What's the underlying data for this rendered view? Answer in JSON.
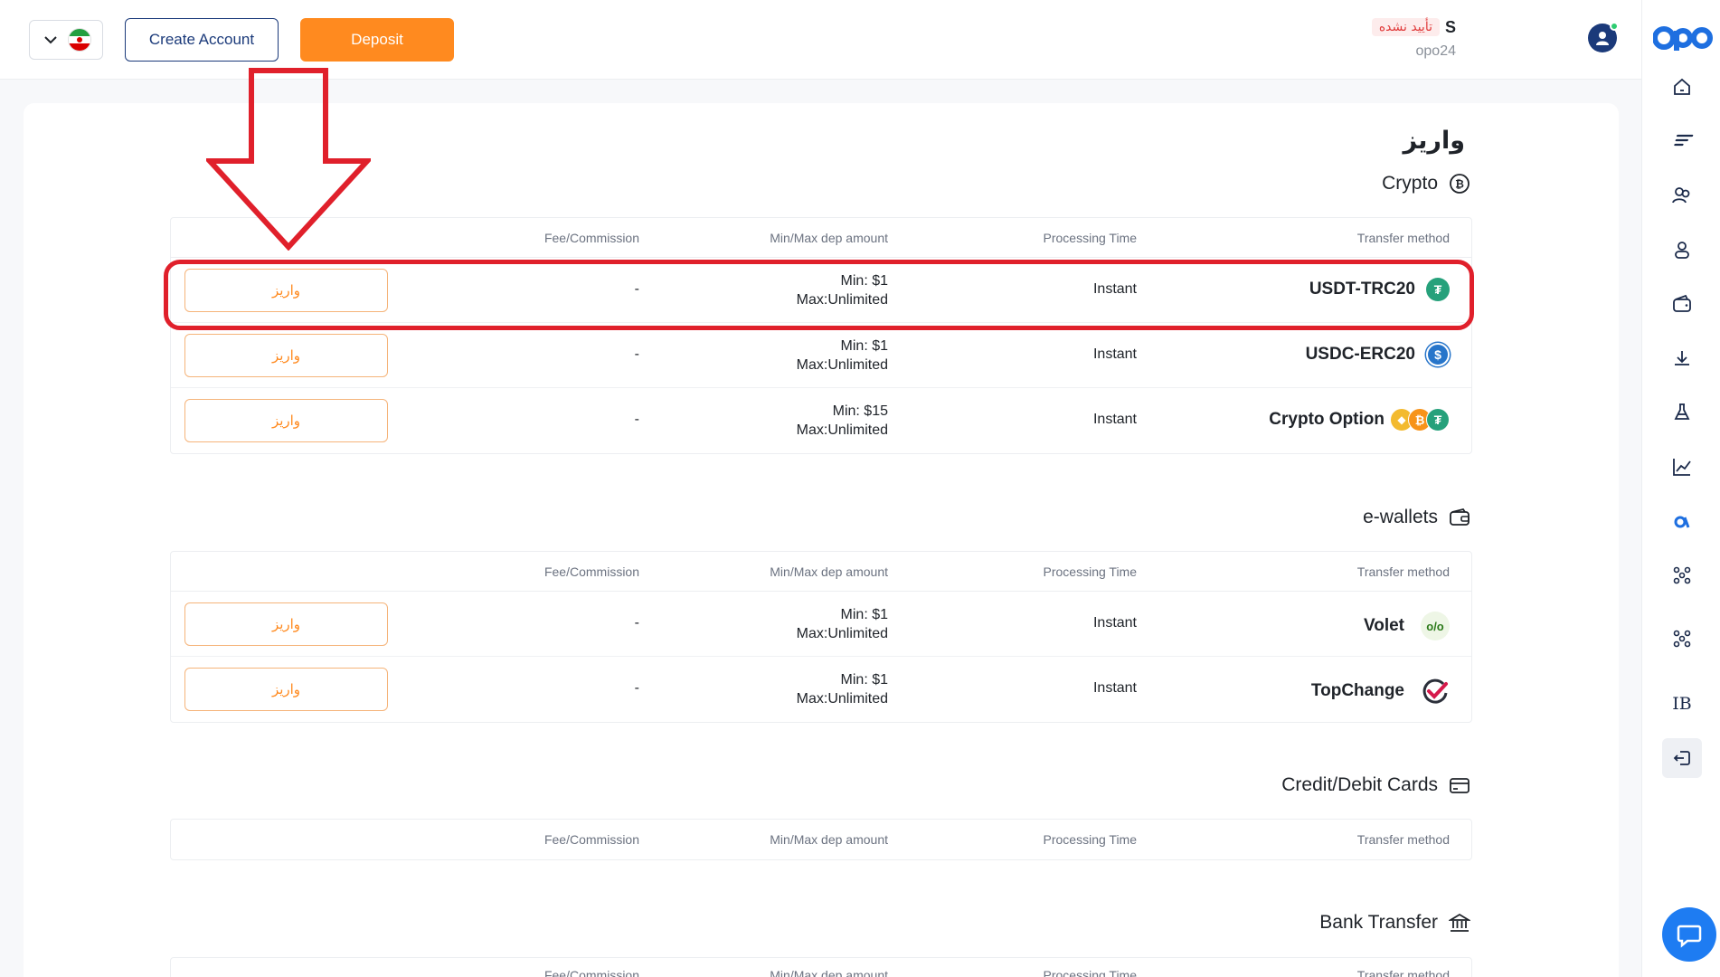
{
  "header": {
    "create_account": "Create Account",
    "deposit": "Deposit",
    "verify_status": "تأیید نشده",
    "user_initial": "S",
    "user_id": "opo24"
  },
  "page": {
    "title": "واریز"
  },
  "columns": {
    "fee": "Fee/Commission",
    "minmax": "Min/Max dep amount",
    "processing": "Processing Time",
    "method": "Transfer method"
  },
  "deposit_label": "واریز",
  "sections": [
    {
      "title": "Crypto",
      "icon": "bitcoin-circle-icon",
      "rows": [
        {
          "method": "USDT-TRC20",
          "icon": "tether-icon",
          "processing": "Instant",
          "min": "Min: $1",
          "max": "Max:Unlimited",
          "fee": "-"
        },
        {
          "method": "USDC-ERC20",
          "icon": "usdc-icon",
          "processing": "Instant",
          "min": "Min: $1",
          "max": "Max:Unlimited",
          "fee": "-"
        },
        {
          "method": "Crypto Option",
          "icon": "crypto-coins-icon",
          "processing": "Instant",
          "min": "Min: $15",
          "max": "Max:Unlimited",
          "fee": "-"
        }
      ]
    },
    {
      "title": "e-wallets",
      "icon": "wallet-icon",
      "rows": [
        {
          "method": "Volet",
          "icon": "volet-icon",
          "processing": "Instant",
          "min": "Min: $1",
          "max": "Max:Unlimited",
          "fee": "-"
        },
        {
          "method": "TopChange",
          "icon": "topchange-icon",
          "processing": "Instant",
          "min": "Min: $1",
          "max": "Max:Unlimited",
          "fee": "-"
        }
      ]
    },
    {
      "title": "Credit/Debit Cards",
      "icon": "credit-card-icon",
      "rows": []
    },
    {
      "title": "Bank Transfer",
      "icon": "bank-icon",
      "rows": []
    }
  ],
  "sidebar": {
    "ib_label": "IB"
  },
  "colors": {
    "accent": "#ff8a1f",
    "brand": "#1b3a7a",
    "annotation": "#e0202b",
    "tether": "#26a17b",
    "usdc": "#2775ca"
  }
}
